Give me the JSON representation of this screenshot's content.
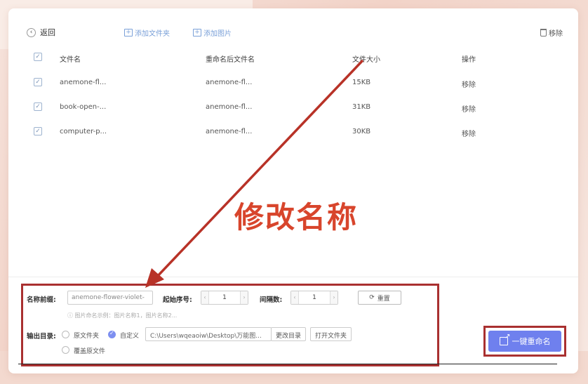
{
  "toolbar": {
    "back_label": "返回",
    "add_folder_label": "添加文件夹",
    "add_image_label": "添加图片",
    "remove_label": "移除"
  },
  "table": {
    "headers": [
      "文件名",
      "重命名后文件名",
      "文件大小",
      "操作"
    ],
    "rows": [
      {
        "name": "anemone-fl...",
        "new_name": "anemone-fl...",
        "size": "15KB",
        "op": "移除"
      },
      {
        "name": "book-open-...",
        "new_name": "anemone-fl...",
        "size": "31KB",
        "op": "移除"
      },
      {
        "name": "computer-p...",
        "new_name": "anemone-fl...",
        "size": "30KB",
        "op": "移除"
      }
    ]
  },
  "annotation": {
    "label": "修改名称",
    "color": "#d8452c"
  },
  "settings": {
    "prefix_label": "名称前缀:",
    "prefix_value": "anemone-flower-violet-",
    "start_label": "起始序号:",
    "start_value": "1",
    "interval_label": "间隔数:",
    "interval_value": "1",
    "reset_label": "重置",
    "hint": "ⓘ 图片命名示例：图片名称1，图片名称2...",
    "output_label": "输出目录:",
    "opt_original_folder": "原文件夹",
    "opt_custom": "自定义",
    "path_value": "C:\\Users\\wqeaoiw\\Desktop\\万能图...",
    "change_dir_label": "更改目录",
    "open_folder_label": "打开文件夹",
    "opt_overwrite": "覆盖原文件"
  },
  "action": {
    "rename_all_label": "一键重命名",
    "accent": "#6f80ee",
    "highlight": "#a93030"
  }
}
